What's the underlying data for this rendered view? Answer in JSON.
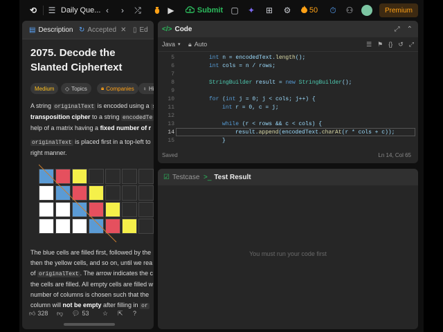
{
  "topbar": {
    "logo": "⟲",
    "list_icon": "☰",
    "problem_list_label": "Daily Que...",
    "prev_icon": "‹",
    "next_icon": "›",
    "shuffle_icon": "⤮",
    "debug_icon": "🐞",
    "run_icon": "▶",
    "submit_label": "Submit",
    "note_icon": "▢",
    "ai_icon": "✦",
    "grid_icon": "⊞",
    "settings_icon": "⚙",
    "streak_count": "50",
    "timer_icon": "⏱",
    "adduser_icon": "⚇",
    "premium_label": "Premium"
  },
  "left_tabs": [
    {
      "label": "Description",
      "icon": "description-icon",
      "glyph": "▤",
      "active": true
    },
    {
      "label": "Accepted",
      "icon": "accepted-icon",
      "glyph": "↻",
      "active": false
    },
    {
      "label": "Ed",
      "icon": "editorial-icon",
      "glyph": "▯",
      "active": false
    }
  ],
  "problem": {
    "title_line1": "2075. Decode the",
    "title_line2": "Slanted Ciphertext",
    "difficulty": "Medium",
    "topics": "Topics",
    "companies": "Companies",
    "hint": "Hi",
    "p1_l1_a": "A string ",
    "p1_l1_code": "originalText",
    "p1_l1_b": " is encoded using a ",
    "p1_l1_c": "s",
    "p1_l2_bold": "transposition cipher",
    "p1_l2_a": " to a string ",
    "p1_l2_code": "encodedTe",
    "p1_l3_a": "help of a matrix having a ",
    "p1_l3_bold": "fixed number of r",
    "p2_l1_code": "originalText",
    "p2_l1_a": " is placed first in a top-left to",
    "p2_l2": "right manner.",
    "p3_l1": "The blue cells are filled first, followed by the",
    "p3_l2": "then the yellow cells, and so on, until we rea",
    "p3_l3_a": "of ",
    "p3_l3_code": "originalText",
    "p3_l3_b": ". The arrow indicates the c",
    "p3_l4": "the cells are filled. All empty cells are filled w",
    "p3_l5": "number of columns is chosen such that the",
    "p3_l6_a": "column will ",
    "p3_l6_bold": "not be empty",
    "p3_l6_b": " after filling in ",
    "p3_l6_code": "or"
  },
  "footer": {
    "likes": "328",
    "comments": "53"
  },
  "matrix_colors": {
    "blue": "#5b9bd5",
    "red": "#e5505e",
    "yellow": "#f5f04a",
    "white": "#ffffff",
    "dark": "#2b2b2b",
    "arrow": "#c97d2f"
  },
  "code_panel": {
    "title": "Code",
    "language": "Java",
    "auto": "Auto",
    "status_left": "Saved",
    "status_right": "Ln 14, Col 65"
  },
  "code_lines": [
    {
      "n": "5"
    },
    {
      "n": "6"
    },
    {
      "n": "7"
    },
    {
      "n": "8"
    },
    {
      "n": "9"
    },
    {
      "n": "10"
    },
    {
      "n": "11"
    },
    {
      "n": "12"
    },
    {
      "n": "13"
    },
    {
      "n": "14"
    },
    {
      "n": "15"
    }
  ],
  "code_text": {
    "l5_a": "int",
    "l5_b": " n = encodedText.",
    "l5_c": "length",
    "l5_d": "();",
    "l6_a": "int",
    "l6_b": " cols = n / rows;",
    "l8_a": "StringBuilder",
    "l8_b": " result = ",
    "l8_c": "new",
    "l8_d": " ",
    "l8_e": "StringBuilder",
    "l8_f": "();",
    "l10_a": "for",
    "l10_b": " (",
    "l10_c": "int",
    "l10_d": " j = 0; j < cols; j++) {",
    "l11_a": "int",
    "l11_b": " r = 0, c = j;",
    "l13_a": "while",
    "l13_b": " (r < rows && c < cols) {",
    "l14_a": "result.",
    "l14_b": "append",
    "l14_c": "(encodedText.",
    "l14_d": "charAt",
    "l14_e": "(r * cols + c));",
    "l15": "}"
  },
  "test_panel": {
    "tab1": "Testcase",
    "tab2": "Test Result",
    "empty_message": "You must run your code first"
  }
}
